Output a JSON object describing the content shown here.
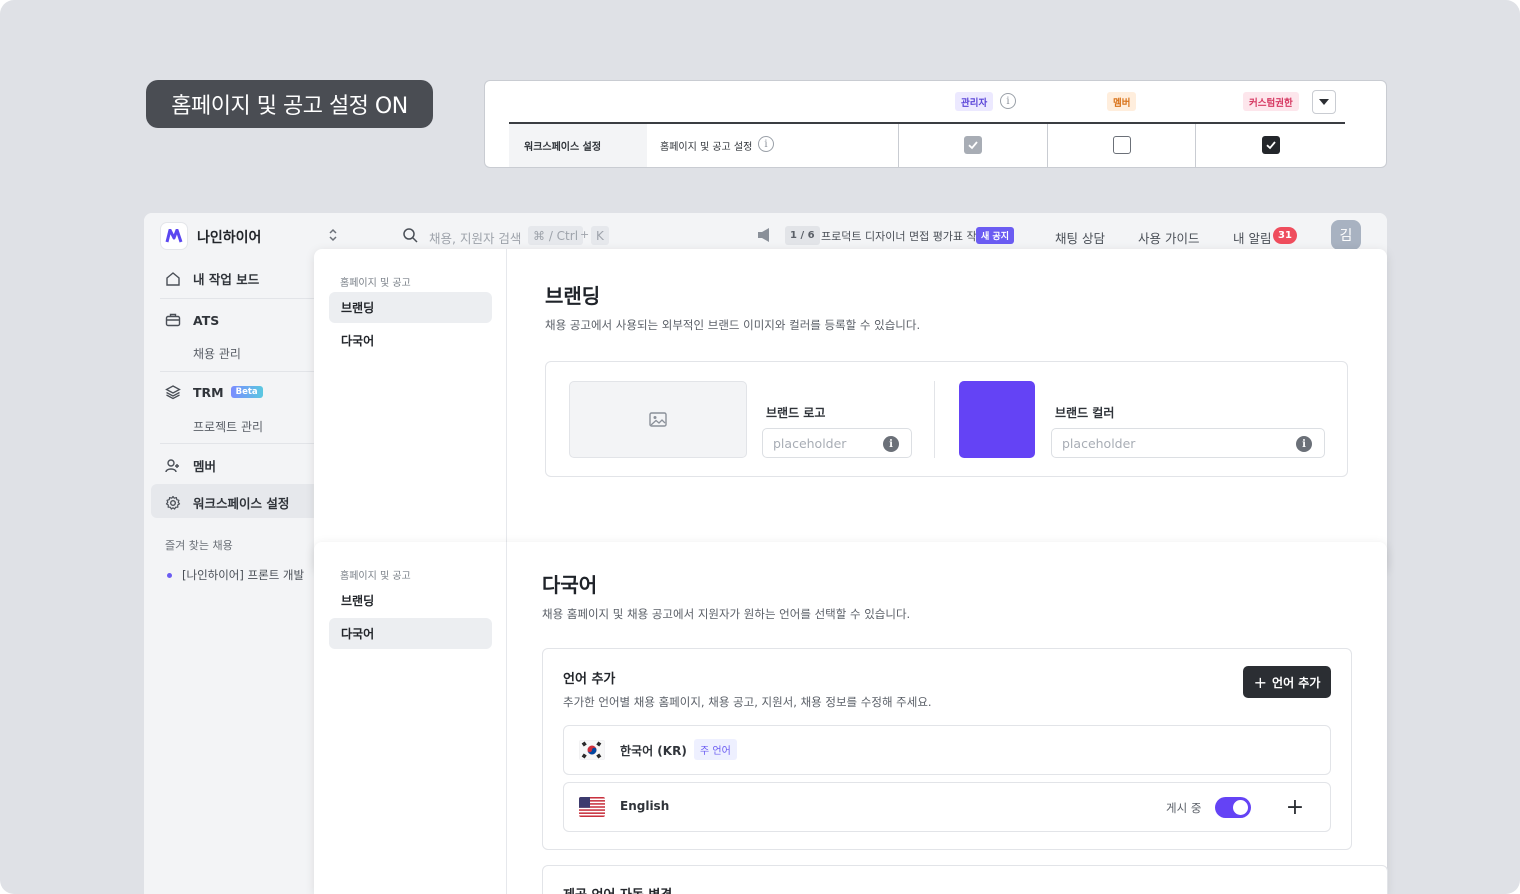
{
  "pill_label": "홈페이지 및 공고 설정 ON",
  "permissions": {
    "roles": [
      "관리자",
      "멤버",
      "커스텀권한"
    ],
    "row_category": "워크스페이스 설정",
    "row_name": "홈페이지 및 공고 설정",
    "info_glyph": "i",
    "checkbox_states": [
      "checked-disabled",
      "unchecked",
      "checked"
    ]
  },
  "topbar": {
    "search_placeholder": "채용, 지원자 검색",
    "shortcut_cmd": "⌘ / Ctrl",
    "shortcut_plus": "+",
    "shortcut_key": "K",
    "notice_counter": "1 / 6",
    "notice_text": "프로덕트 디자이너 면접 평가표 작...",
    "notice_new": "새 공지",
    "chat": "채팅 상담",
    "guide": "사용 가이드",
    "alarm": "내 알림",
    "alarm_count": "31",
    "avatar": "김"
  },
  "sidebar": {
    "workspace_name": "나인하이어",
    "items": [
      {
        "label": "내 작업 보드",
        "icon": "home-icon"
      },
      {
        "label": "ATS",
        "icon": "briefcase-icon"
      },
      {
        "label": "TRM",
        "icon": "layers-icon",
        "badge": "Beta"
      },
      {
        "label": "멤버",
        "icon": "add-user-icon"
      },
      {
        "label": "워크스페이스 설정",
        "icon": "gear-icon"
      }
    ],
    "ats_sub": "채용 관리",
    "trm_sub": "프로젝트 관리",
    "fav_title": "즐겨 찾는 채용",
    "fav_item": "[나인하이어] 프론트 개발"
  },
  "card1": {
    "nav_title": "홈페이지 및 공고",
    "nav_items": [
      "브랜딩",
      "다국어"
    ],
    "title": "브랜딩",
    "desc": "채용 공고에서 사용되는 외부적인 브랜드 이미지와 컬러를 등록할 수 있습니다.",
    "logo_label": "브랜드 로고",
    "logo_placeholder": "placeholder",
    "color_label": "브랜드 컬러",
    "color_placeholder": "placeholder",
    "brand_color": "#6443f5"
  },
  "card2": {
    "nav_title": "홈페이지 및 공고",
    "nav_items": [
      "브랜딩",
      "다국어"
    ],
    "title": "다국어",
    "desc": "채용 홈페이지 및 채용 공고에서 지원자가 원하는 언어를 선택할 수 있습니다.",
    "section_title": "언어 추가",
    "section_desc": "추가한 언어별 채용 홈페이지, 채용 공고, 지원서, 채용 정보를 수정해 주세요.",
    "add_button": "언어 추가",
    "languages": [
      {
        "name": "한국어 (KR)",
        "tag": "주 언어",
        "flag": "kr-flag-icon"
      },
      {
        "name": "English",
        "status": "게시 중",
        "flag": "us-flag-icon",
        "published": true
      }
    ],
    "next_section_title": "제공 언어 자동 변경"
  }
}
